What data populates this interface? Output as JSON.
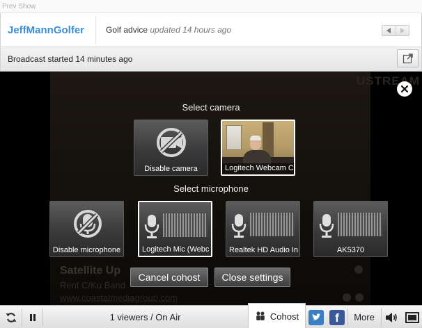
{
  "prev_show": {
    "label": "Prev Show"
  },
  "header": {
    "channel_name": "JeffMannGolfer",
    "show_title": "Golf advice",
    "show_updated": "updated 14 hours ago"
  },
  "broadcast": {
    "status_text": "Broadcast started 14 minutes ago"
  },
  "settings_dialog": {
    "camera_heading": "Select camera",
    "cameras": [
      {
        "label": "Disable camera",
        "icon": "camera-off-icon",
        "selected": false
      },
      {
        "label": "Logitech Webcam C",
        "icon": "webcam-preview",
        "selected": true
      }
    ],
    "microphone_heading": "Select microphone",
    "microphones": [
      {
        "label": "Disable microphone",
        "icon": "mic-off-icon",
        "selected": false
      },
      {
        "label": "Logitech Mic (Webc",
        "icon": "mic-icon",
        "selected": true
      },
      {
        "label": "Realtek HD Audio In",
        "icon": "mic-icon",
        "selected": false
      },
      {
        "label": "AK5370",
        "icon": "mic-icon",
        "selected": false
      }
    ],
    "cancel_cohost_label": "Cancel cohost",
    "close_settings_label": "Close settings"
  },
  "background_ad": {
    "headline": "Satellite Up",
    "body": "Rent C/Ku Band",
    "link": "www.coastalmediagroup.com"
  },
  "control_bar": {
    "viewers_text": "1 viewers / On Air",
    "cohost_label": "Cohost",
    "more_label": "More"
  },
  "colors": {
    "channel_link": "#3a8ddb",
    "twitter": "#3a7fc2",
    "facebook": "#3b5998",
    "player_bg": "#000000"
  }
}
